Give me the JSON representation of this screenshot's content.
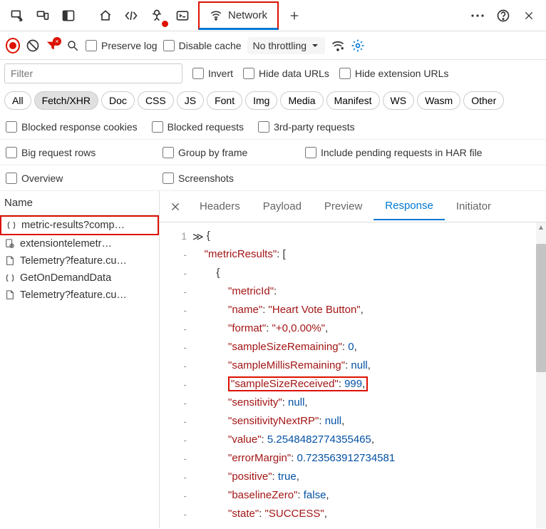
{
  "top_tabs": {
    "network_label": "Network"
  },
  "toolbar": {
    "preserve_log": "Preserve log",
    "disable_cache": "Disable cache",
    "throttling": "No throttling"
  },
  "filter": {
    "placeholder": "Filter",
    "invert": "Invert",
    "hide_data_urls": "Hide data URLs",
    "hide_ext_urls": "Hide extension URLs"
  },
  "types": {
    "all": "All",
    "fetch": "Fetch/XHR",
    "doc": "Doc",
    "css": "CSS",
    "js": "JS",
    "font": "Font",
    "img": "Img",
    "media": "Media",
    "manifest": "Manifest",
    "ws": "WS",
    "wasm": "Wasm",
    "other": "Other"
  },
  "checks": {
    "blocked_cookies": "Blocked response cookies",
    "blocked_requests": "Blocked requests",
    "third_party": "3rd-party requests",
    "big_rows": "Big request rows",
    "group_frame": "Group by frame",
    "include_har": "Include pending requests in HAR file",
    "overview": "Overview",
    "screenshots": "Screenshots"
  },
  "name_panel": {
    "header": "Name",
    "items": [
      {
        "label": "metric-results?comp…",
        "icon": "json"
      },
      {
        "label": "extensiontelemetr…",
        "icon": "doc-gear"
      },
      {
        "label": "Telemetry?feature.cu…",
        "icon": "doc"
      },
      {
        "label": "GetOnDemandData",
        "icon": "json"
      },
      {
        "label": "Telemetry?feature.cu…",
        "icon": "doc"
      }
    ]
  },
  "detail_tabs": {
    "headers": "Headers",
    "payload": "Payload",
    "preview": "Preview",
    "response": "Response",
    "initiator": "Initiator"
  },
  "json_preview": {
    "line_no_first": "1",
    "root_key": "metricResults",
    "fields": {
      "metricId": "metricId",
      "name_key": "name",
      "name_val": "Heart Vote Button",
      "format_key": "format",
      "format_val": "+0,0.00%",
      "ssr_key": "sampleSizeRemaining",
      "ssr_val": "0",
      "smr_key": "sampleMillisRemaining",
      "smr_val": "null",
      "ssrec_key": "sampleSizeReceived",
      "ssrec_val": "999",
      "sens_key": "sensitivity",
      "sens_val": "null",
      "sensnrp_key": "sensitivityNextRP",
      "sensnrp_val": "null",
      "value_key": "value",
      "value_val": "5.2548482774355465",
      "em_key": "errorMargin",
      "em_val": "0.723563912734581",
      "pos_key": "positive",
      "pos_val": "true",
      "bz_key": "baselineZero",
      "bz_val": "false",
      "state_key": "state",
      "state_val": "SUCCESS"
    }
  }
}
